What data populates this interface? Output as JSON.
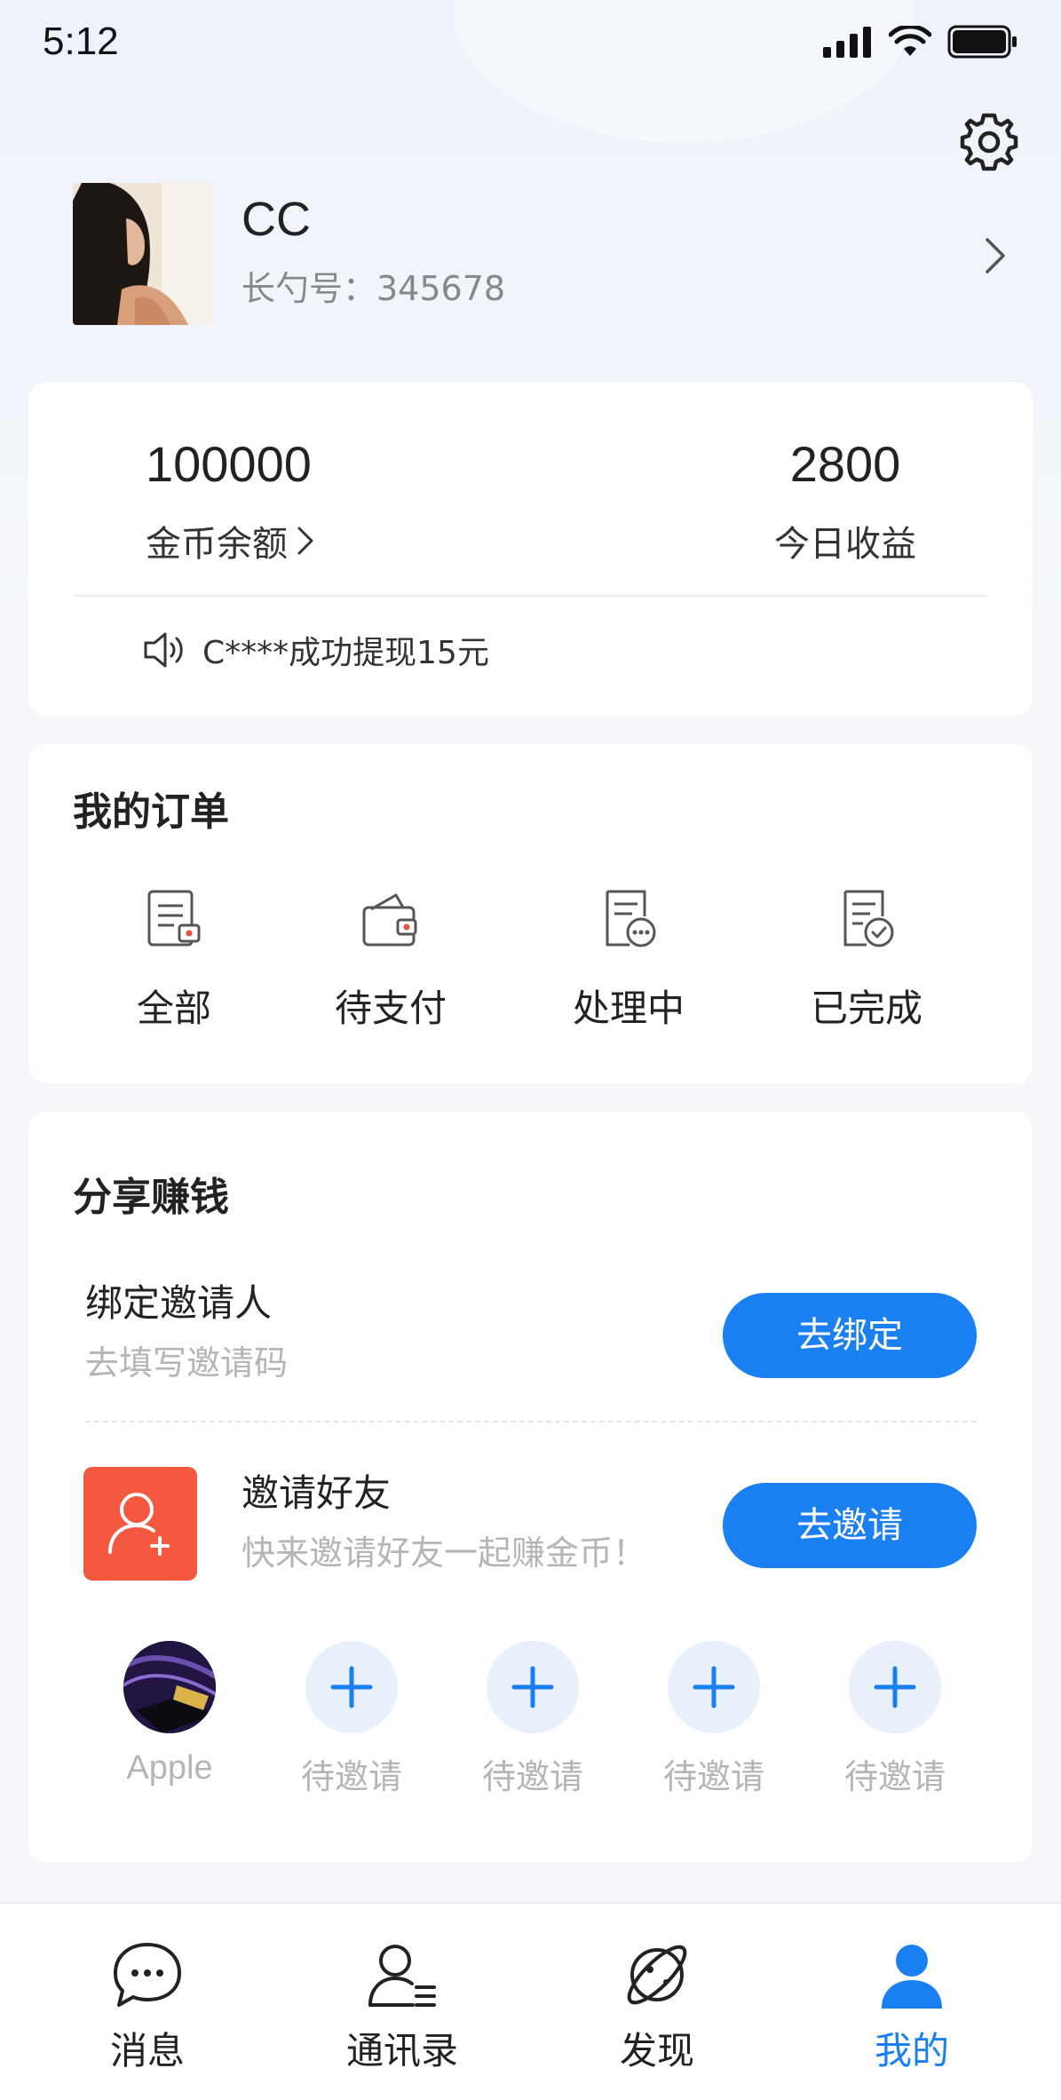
{
  "status_bar": {
    "time": "5:12"
  },
  "profile": {
    "name": "CC",
    "id_label": "长勺号：345678"
  },
  "wallet": {
    "coin_value": "100000",
    "coin_label": "金币余额",
    "today_value": "2800",
    "today_label": "今日收益",
    "notice": "C****成功提现15元"
  },
  "orders": {
    "title": "我的订单",
    "items": [
      {
        "label": "全部",
        "icon": "document-icon"
      },
      {
        "label": "待支付",
        "icon": "wallet-icon"
      },
      {
        "label": "处理中",
        "icon": "processing-doc-icon"
      },
      {
        "label": "已完成",
        "icon": "completed-doc-icon"
      }
    ]
  },
  "share": {
    "title": "分享赚钱",
    "bind": {
      "title": "绑定邀请人",
      "subtitle": "去填写邀请码",
      "button": "去绑定"
    },
    "invite": {
      "title": "邀请好友",
      "subtitle": "快来邀请好友一起赚金币！",
      "button": "去邀请"
    },
    "friends": [
      {
        "label": "Apple"
      },
      {
        "label": "待邀请"
      },
      {
        "label": "待邀请"
      },
      {
        "label": "待邀请"
      },
      {
        "label": "待邀请"
      }
    ]
  },
  "tabbar": {
    "items": [
      {
        "label": "消息",
        "icon": "chat-bubble-icon"
      },
      {
        "label": "通讯录",
        "icon": "contacts-icon"
      },
      {
        "label": "发现",
        "icon": "planet-icon"
      },
      {
        "label": "我的",
        "icon": "user-icon",
        "active": true
      }
    ]
  },
  "colors": {
    "accent": "#1a7ff0",
    "invite_badge": "#f4583e",
    "muted_text": "#b5b5b5"
  }
}
